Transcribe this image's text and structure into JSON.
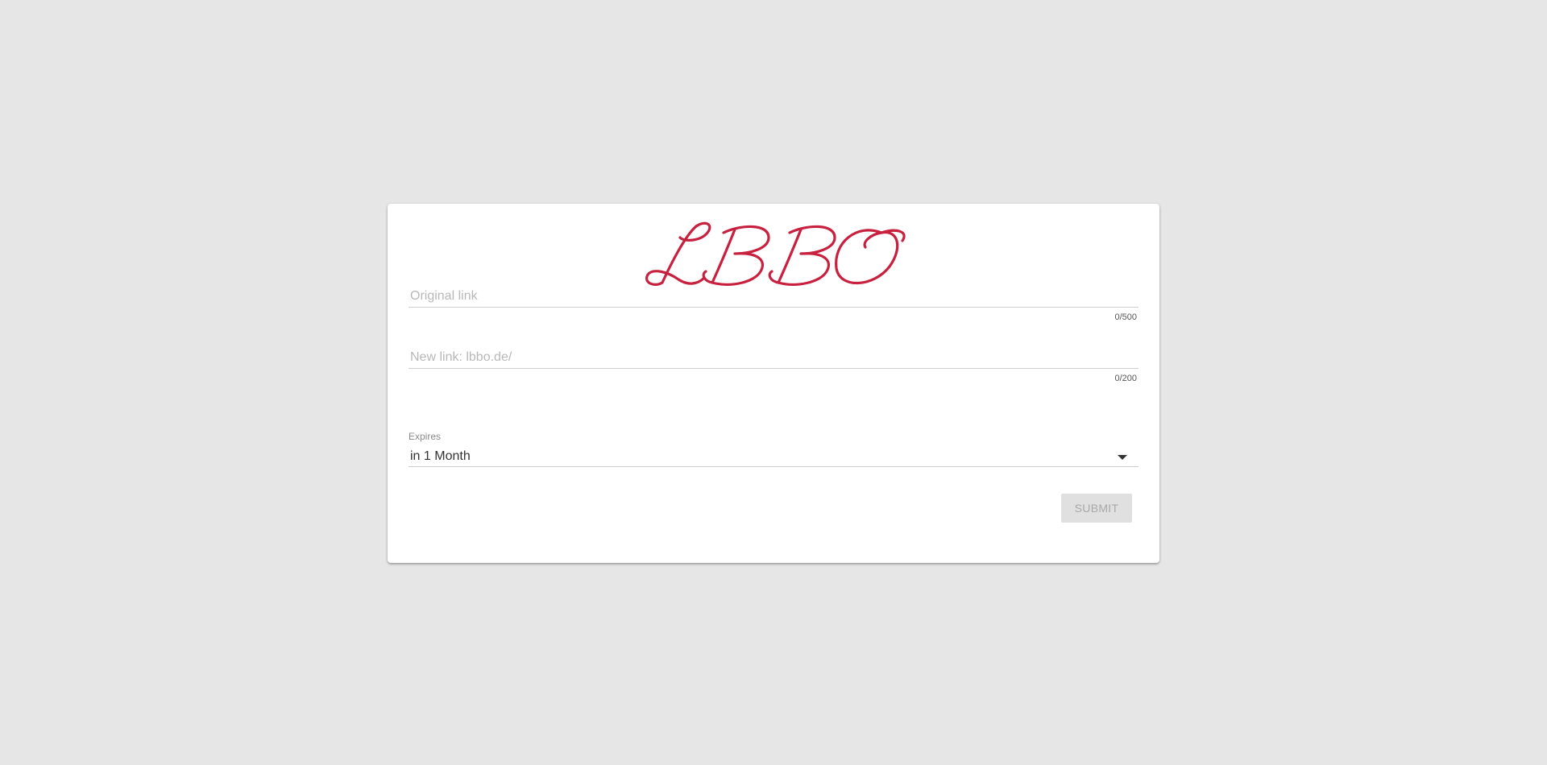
{
  "brand": {
    "logo_text": "LBBO",
    "logo_color": "#c8203f"
  },
  "form": {
    "original_link": {
      "placeholder": "Original link",
      "counter": "0/500"
    },
    "new_link": {
      "placeholder": "New link: lbbo.de/",
      "counter": "0/200"
    },
    "expires": {
      "label": "Expires",
      "selected": "in 1 Month"
    },
    "submit_label": "SUBMIT"
  }
}
